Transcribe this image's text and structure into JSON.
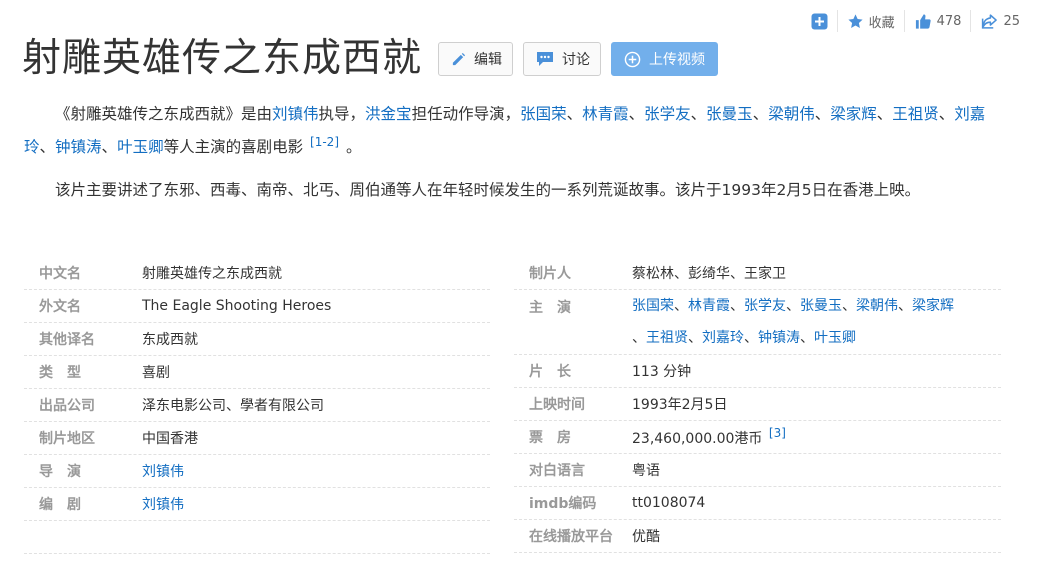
{
  "toolbar": {
    "add_label": "",
    "favorite_label": "收藏",
    "like_count": "478",
    "share_count": "25"
  },
  "title": "射雕英雄传之东成西就",
  "buttons": {
    "edit": "编辑",
    "discuss": "讨论",
    "upload_video": "上传视频"
  },
  "intro": {
    "p1_prefix": "《射雕英雄传之东成西就》是由",
    "director": "刘镇伟",
    "p1_mid1": "执导，",
    "action_director": "洪金宝",
    "p1_mid2": "担任动作导演，",
    "cast": [
      "张国荣",
      "林青霞",
      "张学友",
      "张曼玉",
      "梁朝伟",
      "梁家辉",
      "王祖贤",
      "刘嘉玲",
      "钟镇涛",
      "叶玉卿"
    ],
    "separator": "、",
    "p1_suffix": "等人主演的喜剧电影",
    "p1_ref": "[1-2]",
    "p1_end": "。",
    "p2": "该片主要讲述了东邪、西毒、南帝、北丐、周伯通等人在年轻时候发生的一系列荒诞故事。该片于1993年2月5日在香港上映。"
  },
  "info_left": [
    {
      "key": "中文名",
      "value": "射雕英雄传之东成西就",
      "link": false
    },
    {
      "key": "外文名",
      "value": "The Eagle Shooting Heroes",
      "link": false
    },
    {
      "key": "其他译名",
      "value": "东成西就",
      "link": false
    },
    {
      "key": "类　型",
      "value": "喜剧",
      "link": false
    },
    {
      "key": "出品公司",
      "value": "泽东电影公司、學者有限公司",
      "link": false
    },
    {
      "key": "制片地区",
      "value": "中国香港",
      "link": false
    },
    {
      "key": "导　演",
      "value": "刘镇伟",
      "link": true
    },
    {
      "key": "编　剧",
      "value": "刘镇伟",
      "link": true
    }
  ],
  "info_right": {
    "producer_key": "制片人",
    "producer_value": "蔡松林、彭绮华、王家卫",
    "cast_key": "主　演",
    "cast_line1": [
      "张国荣",
      "林青霞",
      "张学友",
      "张曼玉",
      "梁朝伟",
      "梁家辉"
    ],
    "cast_line2": [
      "王祖贤",
      "刘嘉玲",
      "钟镇涛",
      "叶玉卿"
    ],
    "runtime_key": "片　长",
    "runtime_value": "113 分钟",
    "release_key": "上映时间",
    "release_value": "1993年2月5日",
    "boxoffice_key": "票　房",
    "boxoffice_value": "23,460,000.00港币",
    "boxoffice_ref": "[3]",
    "language_key": "对白语言",
    "language_value": "粤语",
    "imdb_key": "imdb编码",
    "imdb_value": "tt0108074",
    "platform_key": "在线播放平台",
    "platform_value": "优酷"
  }
}
